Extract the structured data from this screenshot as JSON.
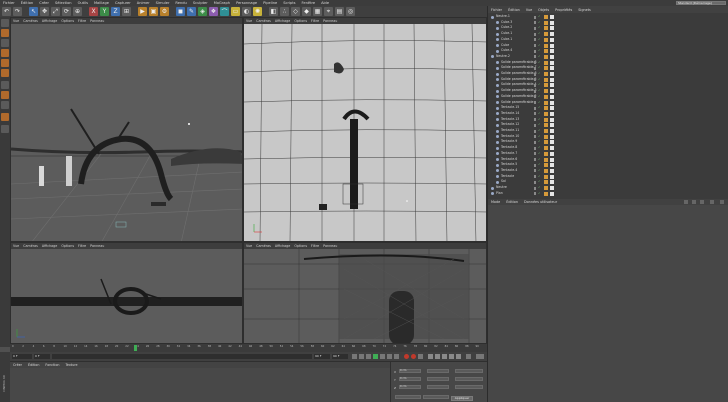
{
  "menubar": {
    "items": [
      "Fichier",
      "Édition",
      "Créer",
      "Sélection",
      "Outils",
      "Maillage",
      "Capturer",
      "Animer",
      "Simuler",
      "Rendu",
      "Sculpter",
      "MoGraph",
      "Personnage",
      "Pipeline",
      "Scripts",
      "Fenêtre",
      "Aide"
    ],
    "layout_label": "Interface :",
    "layout_value": "Standard (Démarrage)"
  },
  "viewports": {
    "menu_items": [
      "Vue",
      "Caméras",
      "Affichage",
      "Options",
      "Filtre",
      "Panneau"
    ],
    "top_left_label": "Perspective",
    "bottom_left_label": "Droite",
    "top_right_label": "Face",
    "bottom_right_label": "Dessus"
  },
  "object_manager": {
    "menu": [
      "Fichier",
      "Édition",
      "Vue",
      "Objets",
      "Propriétés",
      "Signets"
    ],
    "rows": [
      {
        "name": "Neutre.1",
        "indent": 0,
        "selected": false
      },
      {
        "name": "Cube.3",
        "indent": 1,
        "selected": false
      },
      {
        "name": "Cube.2",
        "indent": 1,
        "selected": false
      },
      {
        "name": "Cube.1",
        "indent": 1,
        "selected": false
      },
      {
        "name": "Cube.1",
        "indent": 1,
        "selected": false
      },
      {
        "name": "Cube",
        "indent": 1,
        "selected": false
      },
      {
        "name": "Cube.4",
        "indent": 1,
        "selected": false
      },
      {
        "name": "Neutre.2",
        "indent": 0,
        "selected": false
      },
      {
        "name": "Solide paramétrable.8",
        "indent": 1,
        "selected": false
      },
      {
        "name": "Solide paramétrable.7",
        "indent": 1,
        "selected": false
      },
      {
        "name": "Solide paramétrable.6",
        "indent": 1,
        "selected": false
      },
      {
        "name": "Solide paramétrable.5",
        "indent": 1,
        "selected": false
      },
      {
        "name": "Solide paramétrable.4",
        "indent": 1,
        "selected": false
      },
      {
        "name": "Solide paramétrable.3",
        "indent": 1,
        "selected": false
      },
      {
        "name": "Solide paramétrable.2",
        "indent": 1,
        "selected": false
      },
      {
        "name": "Solide paramétrable",
        "indent": 1,
        "selected": false
      },
      {
        "name": "Tentacle.15",
        "indent": 1,
        "selected": false
      },
      {
        "name": "Tentacle.14",
        "indent": 1,
        "selected": false
      },
      {
        "name": "Tentacle.13",
        "indent": 1,
        "selected": false
      },
      {
        "name": "Tentacle.12",
        "indent": 1,
        "selected": false
      },
      {
        "name": "Tentacle.11",
        "indent": 1,
        "selected": false
      },
      {
        "name": "Tentacle.10",
        "indent": 1,
        "selected": false
      },
      {
        "name": "Tentacle.9",
        "indent": 1,
        "selected": false
      },
      {
        "name": "Tentacle.8",
        "indent": 1,
        "selected": false
      },
      {
        "name": "Tentacle.7",
        "indent": 1,
        "selected": false
      },
      {
        "name": "Tentacle.6",
        "indent": 1,
        "selected": false
      },
      {
        "name": "Tentacle.5",
        "indent": 1,
        "selected": false
      },
      {
        "name": "Tentacle.4",
        "indent": 1,
        "selected": false
      },
      {
        "name": "Tentacle",
        "indent": 1,
        "selected": false
      },
      {
        "name": "Sol",
        "indent": 1,
        "selected": false
      },
      {
        "name": "Neutre",
        "indent": 0,
        "selected": false
      },
      {
        "name": "Plan",
        "indent": 0,
        "selected": false
      }
    ]
  },
  "attribute_manager": {
    "menu": [
      "Mode",
      "Édition",
      "Données utilisateur"
    ]
  },
  "timeline": {
    "ticks": [
      "0",
      "2",
      "4",
      "6",
      "8",
      "10",
      "12",
      "14",
      "16",
      "18",
      "20",
      "22",
      "24",
      "26",
      "28",
      "30",
      "32",
      "34",
      "36",
      "38",
      "40",
      "42",
      "44",
      "46",
      "48",
      "50",
      "52",
      "54",
      "56",
      "58",
      "60",
      "62",
      "64",
      "66",
      "68",
      "70",
      "72",
      "74",
      "76",
      "78",
      "80",
      "82",
      "84",
      "86",
      "88",
      "90"
    ],
    "current_frame": "0 F",
    "start_frame": "0 F",
    "end_frame": "90 F",
    "end_frame2": "90 F",
    "end_label": "0 F"
  },
  "material_manager": {
    "menu": [
      "Créer",
      "Édition",
      "Fonction",
      "Texture"
    ]
  },
  "coordinates": {
    "apply_label": "Appliquer",
    "x_label": "X",
    "y_label": "Y",
    "z_label": "Z",
    "x_value": "0 cm",
    "y_value": "0 cm",
    "z_value": "0 cm"
  },
  "side_label": "CINEMA 4D"
}
